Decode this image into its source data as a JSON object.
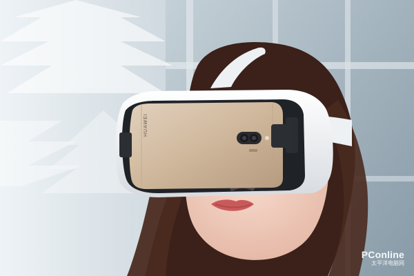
{
  "photo": {
    "subject": "woman-wearing-vr-headset",
    "phone_brand_text": "HUAWEI"
  },
  "watermark": {
    "brand": "PConline",
    "subtitle": "太平洋电脑网"
  },
  "colors": {
    "headset_white": "#f2f3f5",
    "phone_gold": "#cfb79b",
    "hair": "#3b211a",
    "window_light": "#dfe6ea",
    "window_dark": "#8fa1ad"
  }
}
